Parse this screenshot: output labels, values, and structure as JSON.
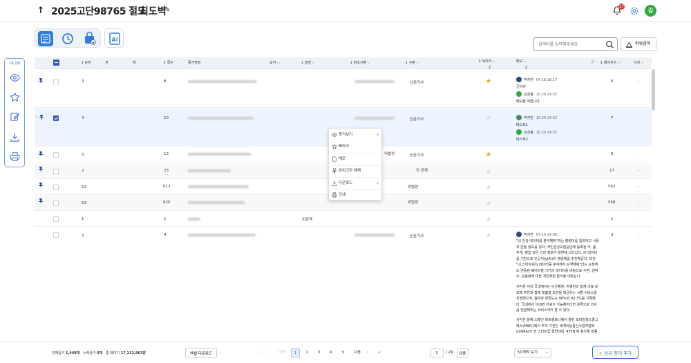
{
  "header": {
    "title": "2025고단98765 절도",
    "subtitle": "최도벽",
    "notification_count": "17",
    "avatar_initial": "김"
  },
  "search": {
    "placeholder": "검색어를 입력해주세요",
    "power_label": "파워검색"
  },
  "sidebar": {
    "selection_label": "1개 선택",
    "icons": [
      "eye-icon",
      "star-icon",
      "edit-icon",
      "download-icon",
      "print-icon"
    ]
  },
  "table": {
    "columns": {
      "order": "순번",
      "volume": "권",
      "volume2": "책",
      "page": "쪽수",
      "evidence": "증거명칭",
      "summary": "요약",
      "description": "설명",
      "reference": "참조사항",
      "category": "구분",
      "bookmark": "북마크",
      "memo": "메모",
      "page_count": "페이지수",
      "cumulative": "누락"
    },
    "bookmark_sub": "Z",
    "memo_sub": "Z",
    "rows": [
      {
        "order": "3",
        "page": "8",
        "category": "신문기사",
        "page_count": "6",
        "cumulative": "-"
      },
      {
        "order": "4",
        "page": "10",
        "category": "신문기사",
        "page_count": "7",
        "cumulative": "-"
      },
      {
        "order": "5",
        "page": "13",
        "category": "신문기사",
        "page_count": "9",
        "cumulative": "-",
        "ref_tail": "위법성"
      },
      {
        "order": "7",
        "page": "23",
        "category": "",
        "page_count": "17",
        "cumulative": "-",
        "ref_tail": "의 관계"
      },
      {
        "order": "52",
        "page": "613",
        "category": "",
        "page_count": "562",
        "cumulative": "-",
        "ref_tail": "위법성"
      },
      {
        "order": "53",
        "page": "620",
        "category": "",
        "page_count": "568",
        "cumulative": "-",
        "ref_tail": "위법성"
      },
      {
        "order": "1",
        "page": "1",
        "description": "이은택",
        "category": "",
        "page_count": "1",
        "cumulative": "-"
      },
      {
        "order": "2",
        "page": "4",
        "category": "신문기사",
        "page_count": "3",
        "cumulative": "-"
      }
    ],
    "memos": {
      "row1": [
        {
          "name": "박지연",
          "time": "04.18.18:17",
          "text": "굿이야"
        },
        {
          "name": "김성봉",
          "time": "10.20.14:35",
          "text": "메모을 적습니다."
        }
      ],
      "row2": [
        {
          "name": "박지연",
          "time": "10.20.14:32",
          "text": "테스트1"
        },
        {
          "name": "김성봉",
          "time": "10.20.14:35",
          "text": "테스트2"
        }
      ],
      "row8": {
        "name": "박지연",
        "time": "04.14.14:06",
        "p1": "\"내 건강 데이터를 분석해줘\"라는 명령어를 입력하고 사용자 만총 정보를 넣자, 국민건강보험공단에 등록된 키, 몸무게, 혈압 같은 건강 정보가 화면에 나타났다. 이 데이터를 기반으로 인공지능(AI)이 영양제를 추천해준다. 또한 \"내 스마트워치 데이터를 분석해서 요약해줘\"라는 요청에도 연동된 웨어러블 기기의 데이터를 바탕으로 수면, 심박수, 운동량에 대한 개인화된 분석을 내놓는다.",
        "p2": "사각은 이의 국내에서는 이산병원, 차병원과 함께 의료 보조제 추천과 함께 맞춤형 조언을 제공하는 시범 서비스를 진행했으며, 참여자 만족도는 96%와 93.7%를 기록했다. 국내에서 비대면 진료가 가능해지다면 원격으로 의사를 연결해주는 서비스까지 할 수 있다.",
        "p3": "사각은 올해 스페인 바르셀로나에서 열린 모바일월드콩그레스(MWC)에서 추치 기관인 세계이동통신사업자협회(GSMA)가 전 스타트업 경연대회 '4YFN'에 참가해 최종"
      }
    }
  },
  "context_menu": {
    "items": [
      {
        "label": "증거보기",
        "icon": "eye-icon",
        "submenu": true
      },
      {
        "label": "북마크",
        "icon": "star-icon",
        "submenu": false
      },
      {
        "label": "메모",
        "icon": "memo-icon",
        "submenu": false
      },
      {
        "label": "위치고정 해제",
        "icon": "pin-icon",
        "submenu": false
      },
      {
        "label": "다운로드",
        "icon": "download-icon",
        "submenu": true
      },
      {
        "label": "인쇄",
        "icon": "print-icon",
        "submenu": false
      }
    ]
  },
  "footer": {
    "total_label": "전체증거",
    "total_value": "1,448개",
    "missing_label": "누락증거",
    "missing_value": "0개",
    "pages_label": "총 페이지",
    "pages_value": "17,113,863장",
    "excel_label": "엑셀 다운로드",
    "prev_label": "이전",
    "next_label": "다음",
    "pages": [
      "1",
      "2",
      "3",
      "4",
      "5"
    ],
    "current_page": "1",
    "total_pages": "29",
    "go_label": "이동",
    "per_page": "50개씩 보기",
    "add_label": "+ 신규 증거 추가"
  },
  "colors": {
    "accent": "#2b66d9",
    "star_active": "#f5a623",
    "row_selected": "#edf4ff"
  }
}
